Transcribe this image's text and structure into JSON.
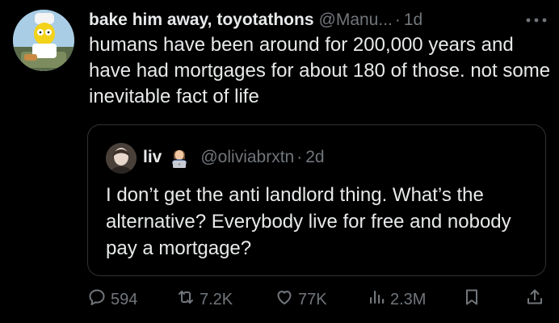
{
  "tweet": {
    "display_name": "bake him away, toyotathons",
    "handle": "@Manu...",
    "separator": "·",
    "time": "1d",
    "text": "humans have been around for 200,000 years and have had mortgages for about 180 of those. not some inevitable fact of life"
  },
  "quoted": {
    "display_name": "liv",
    "emoji": "woman-technologist-emoji",
    "handle": "@oliviabrxtn",
    "separator": "·",
    "time": "2d",
    "text": "I don’t get the anti landlord thing. What’s the alternative? Everybody live for free and nobody pay a mortgage?"
  },
  "actions": {
    "replies": "594",
    "reposts": "7.2K",
    "likes": "77K",
    "views": "2.3M"
  },
  "icons": [
    "more-icon",
    "reply-icon",
    "repost-icon",
    "like-icon",
    "views-icon",
    "bookmark-icon",
    "share-icon"
  ],
  "colors": {
    "background": "#000000",
    "text": "#e7e9ea",
    "secondary": "#71767b",
    "border": "#2f3336"
  }
}
